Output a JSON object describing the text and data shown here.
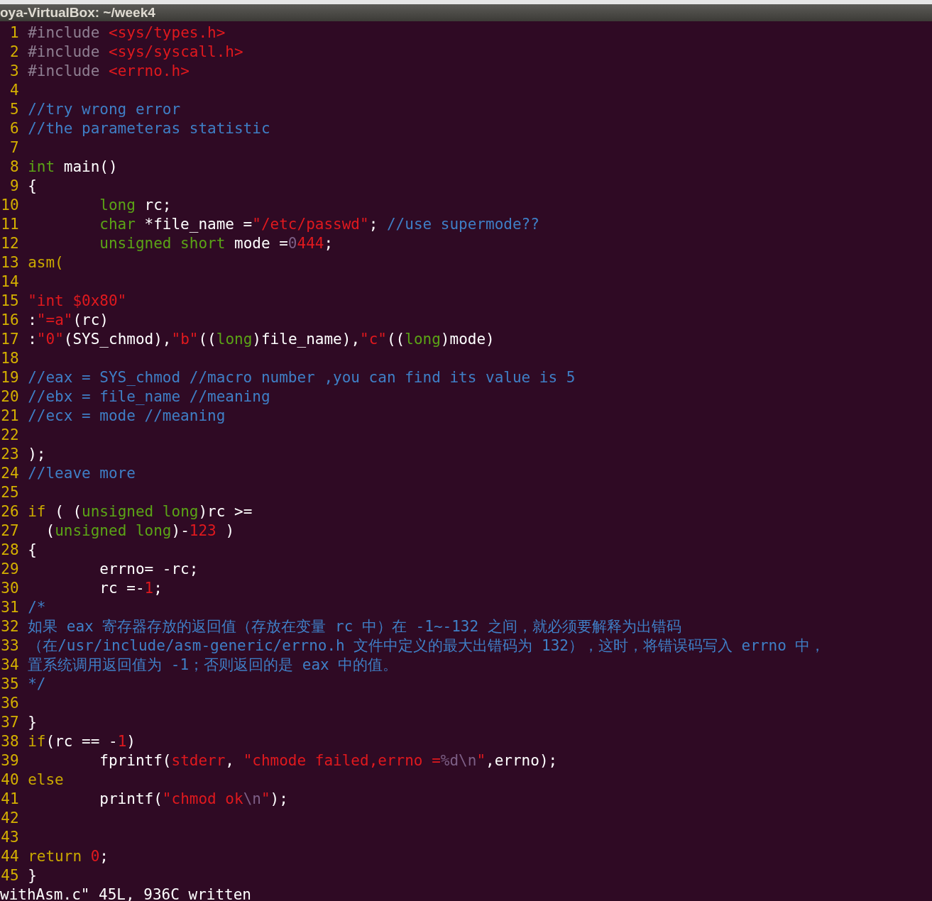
{
  "window": {
    "title": "oya-VirtualBox: ~/week4"
  },
  "editor": {
    "lines": [
      {
        "number": "1",
        "segments": [
          {
            "kind": "preproc",
            "text": "#include"
          },
          {
            "kind": "string",
            "text": " <sys/types.h>"
          }
        ]
      },
      {
        "number": "2",
        "segments": [
          {
            "kind": "preproc",
            "text": "#include"
          },
          {
            "kind": "string",
            "text": " <sys/syscall.h>"
          }
        ]
      },
      {
        "number": "3",
        "segments": [
          {
            "kind": "preproc",
            "text": "#include"
          },
          {
            "kind": "string",
            "text": " <errno.h>"
          }
        ]
      },
      {
        "number": "4"
      },
      {
        "number": "5",
        "segments": [
          {
            "kind": "comment",
            "text": "//try wrong error"
          }
        ]
      },
      {
        "number": "6",
        "segments": [
          {
            "kind": "comment",
            "text": "//the parameteras statistic"
          }
        ]
      },
      {
        "number": "7"
      },
      {
        "number": "8",
        "segments": [
          {
            "kind": "type",
            "text": "int"
          },
          {
            "kind": "plain",
            "text": " main()"
          }
        ]
      },
      {
        "number": "9",
        "segments": [
          {
            "kind": "plain",
            "text": "{"
          }
        ]
      },
      {
        "number": "10",
        "segments": [
          {
            "kind": "type",
            "text": "        long"
          },
          {
            "kind": "plain",
            "text": " rc;"
          }
        ]
      },
      {
        "number": "11",
        "segments": [
          {
            "kind": "type",
            "text": "        char"
          },
          {
            "kind": "plain",
            "text": " *file_name ="
          },
          {
            "kind": "string",
            "text": "\"/etc/passwd\""
          },
          {
            "kind": "plain",
            "text": ";"
          },
          {
            "kind": "comment",
            "text": " //use supermode??"
          }
        ]
      },
      {
        "number": "12",
        "segments": [
          {
            "kind": "type",
            "text": "        unsigned short"
          },
          {
            "kind": "plain",
            "text": " mode ="
          },
          {
            "kind": "special",
            "text": "0"
          },
          {
            "kind": "string",
            "text": "444"
          },
          {
            "kind": "plain",
            "text": ";"
          }
        ]
      },
      {
        "number": "13",
        "segments": [
          {
            "kind": "keyword",
            "text": "asm("
          }
        ]
      },
      {
        "number": "14"
      },
      {
        "number": "15",
        "segments": [
          {
            "kind": "string",
            "text": "\"int $0x80\""
          }
        ]
      },
      {
        "number": "16",
        "segments": [
          {
            "kind": "plain",
            "text": ":"
          },
          {
            "kind": "string",
            "text": "\"=a\""
          },
          {
            "kind": "plain",
            "text": "(rc)"
          }
        ]
      },
      {
        "number": "17",
        "segments": [
          {
            "kind": "plain",
            "text": ":"
          },
          {
            "kind": "string",
            "text": "\"0\""
          },
          {
            "kind": "plain",
            "text": "(SYS_chmod),"
          },
          {
            "kind": "string",
            "text": "\"b\""
          },
          {
            "kind": "plain",
            "text": "(("
          },
          {
            "kind": "type",
            "text": "long"
          },
          {
            "kind": "plain",
            "text": ")file_name),"
          },
          {
            "kind": "string",
            "text": "\"c\""
          },
          {
            "kind": "plain",
            "text": "(("
          },
          {
            "kind": "type",
            "text": "long"
          },
          {
            "kind": "plain",
            "text": ")mode)"
          }
        ]
      },
      {
        "number": "18"
      },
      {
        "number": "19",
        "segments": [
          {
            "kind": "comment",
            "text": "//eax = SYS_chmod //macro number ,you can find its value is 5"
          }
        ]
      },
      {
        "number": "20",
        "segments": [
          {
            "kind": "comment",
            "text": "//ebx = file_name //meaning"
          }
        ]
      },
      {
        "number": "21",
        "segments": [
          {
            "kind": "comment",
            "text": "//ecx = mode //meaning"
          }
        ]
      },
      {
        "number": "22"
      },
      {
        "number": "23",
        "segments": [
          {
            "kind": "plain",
            "text": ");"
          }
        ]
      },
      {
        "number": "24",
        "segments": [
          {
            "kind": "comment",
            "text": "//leave more"
          }
        ]
      },
      {
        "number": "25"
      },
      {
        "number": "26",
        "segments": [
          {
            "kind": "keyword",
            "text": "if"
          },
          {
            "kind": "plain",
            "text": " ( ("
          },
          {
            "kind": "type",
            "text": "unsigned long"
          },
          {
            "kind": "plain",
            "text": ")rc >="
          }
        ]
      },
      {
        "number": "27",
        "segments": [
          {
            "kind": "plain",
            "text": "  ("
          },
          {
            "kind": "type",
            "text": "unsigned long"
          },
          {
            "kind": "plain",
            "text": ")-"
          },
          {
            "kind": "string",
            "text": "123"
          },
          {
            "kind": "plain",
            "text": " )"
          }
        ]
      },
      {
        "number": "28",
        "segments": [
          {
            "kind": "plain",
            "text": "{"
          }
        ]
      },
      {
        "number": "29",
        "segments": [
          {
            "kind": "plain",
            "text": "        errno= -rc;"
          }
        ]
      },
      {
        "number": "30",
        "segments": [
          {
            "kind": "plain",
            "text": "        rc =-"
          },
          {
            "kind": "string",
            "text": "1"
          },
          {
            "kind": "plain",
            "text": ";"
          }
        ]
      },
      {
        "number": "31",
        "segments": [
          {
            "kind": "comment",
            "text": "/*"
          }
        ]
      },
      {
        "number": "32",
        "segments": [
          {
            "kind": "comment",
            "text": "如果 eax 寄存器存放的返回值（存放在变量 rc 中）在 -1~-132 之间，就必须要解释为出错码"
          }
        ]
      },
      {
        "number": "33",
        "segments": [
          {
            "kind": "comment",
            "text": "（在/usr/include/asm-generic/errno.h 文件中定义的最大出错码为 132），这时，将错误码写入 errno 中，"
          }
        ]
      },
      {
        "number": "34",
        "segments": [
          {
            "kind": "comment",
            "text": "置系统调用返回值为 -1；否则返回的是 eax 中的值。"
          }
        ]
      },
      {
        "number": "35",
        "segments": [
          {
            "kind": "comment",
            "text": "*/"
          }
        ]
      },
      {
        "number": "36"
      },
      {
        "number": "37",
        "segments": [
          {
            "kind": "plain",
            "text": "}"
          }
        ]
      },
      {
        "number": "38",
        "segments": [
          {
            "kind": "keyword",
            "text": "if"
          },
          {
            "kind": "plain",
            "text": "(rc == -"
          },
          {
            "kind": "string",
            "text": "1"
          },
          {
            "kind": "plain",
            "text": ")"
          }
        ]
      },
      {
        "number": "39",
        "segments": [
          {
            "kind": "plain",
            "text": "        fprintf("
          },
          {
            "kind": "string",
            "text": "stderr"
          },
          {
            "kind": "plain",
            "text": ", "
          },
          {
            "kind": "string",
            "text": "\"chmode failed,errno ="
          },
          {
            "kind": "special",
            "text": "%d\\n"
          },
          {
            "kind": "string",
            "text": "\""
          },
          {
            "kind": "plain",
            "text": ",errno);"
          }
        ]
      },
      {
        "number": "40",
        "segments": [
          {
            "kind": "keyword",
            "text": "else"
          }
        ]
      },
      {
        "number": "41",
        "segments": [
          {
            "kind": "plain",
            "text": "        printf("
          },
          {
            "kind": "string",
            "text": "\"chmod ok"
          },
          {
            "kind": "special",
            "text": "\\n"
          },
          {
            "kind": "string",
            "text": "\""
          },
          {
            "kind": "plain",
            "text": ");"
          }
        ]
      },
      {
        "number": "42"
      },
      {
        "number": "43"
      },
      {
        "number": "44",
        "segments": [
          {
            "kind": "keyword",
            "text": "return"
          },
          {
            "kind": "string",
            "text": " 0"
          },
          {
            "kind": "plain",
            "text": ";"
          }
        ]
      },
      {
        "number": "45",
        "segments": [
          {
            "kind": "plain",
            "text": "}"
          }
        ]
      }
    ]
  },
  "status_line": "withAsm.c\" 45L, 936C written"
}
